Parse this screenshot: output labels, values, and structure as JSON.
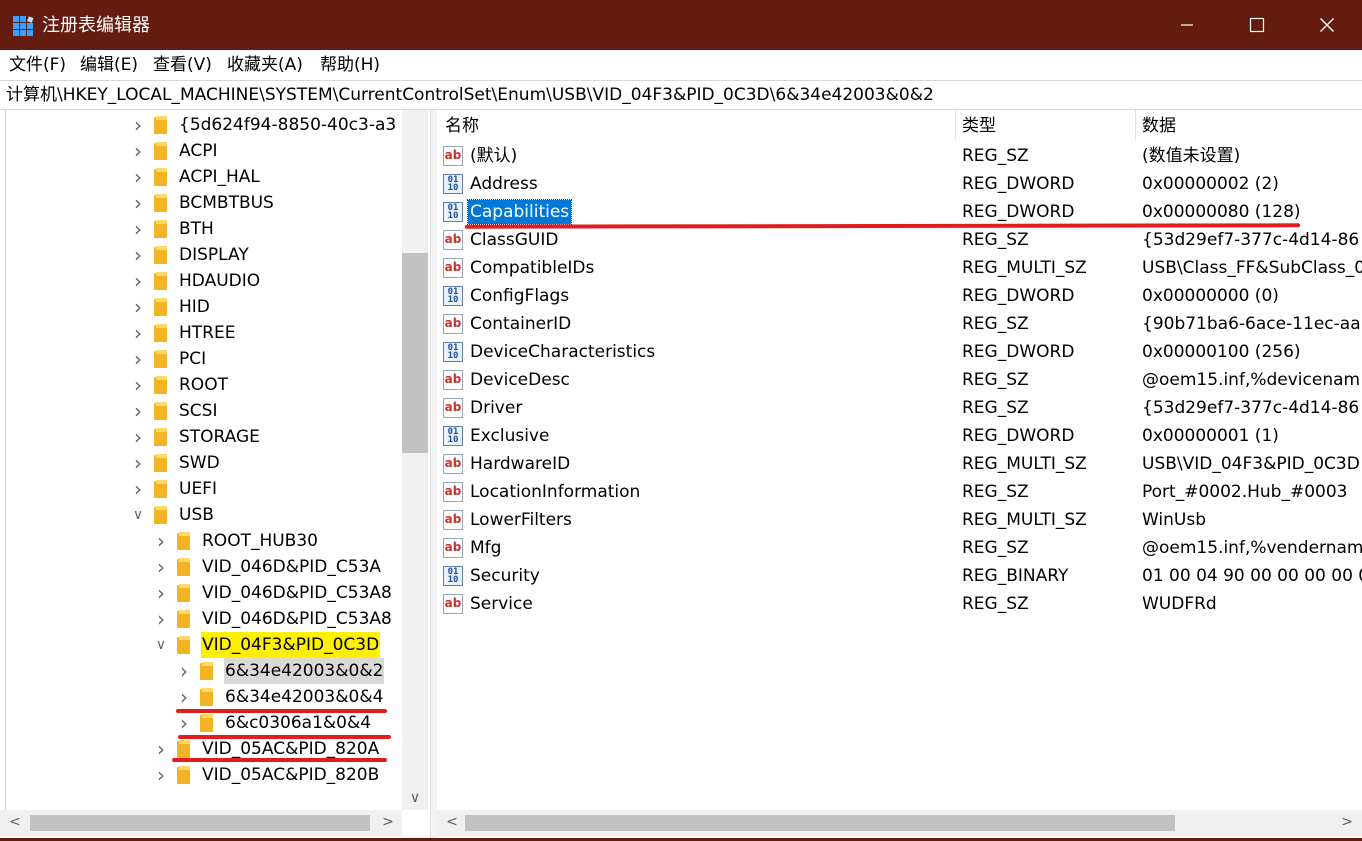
{
  "window": {
    "title": "注册表编辑器",
    "controls": [
      "minimize",
      "maximize",
      "close"
    ]
  },
  "menu": {
    "file": "文件(F)",
    "edit": "编辑(E)",
    "view": "查看(V)",
    "favorites": "收藏夹(A)",
    "help": "帮助(H)"
  },
  "address": {
    "path": "计算机\\HKEY_LOCAL_MACHINE\\SYSTEM\\CurrentControlSet\\Enum\\USB\\VID_04F3&PID_0C3D\\6&34e42003&0&2"
  },
  "tree": {
    "items": [
      {
        "label": "{5d624f94-8850-40c3-a3",
        "expanded": false
      },
      {
        "label": "ACPI",
        "expanded": false
      },
      {
        "label": "ACPI_HAL",
        "expanded": false
      },
      {
        "label": "BCMBTBUS",
        "expanded": false
      },
      {
        "label": "BTH",
        "expanded": false
      },
      {
        "label": "DISPLAY",
        "expanded": false
      },
      {
        "label": "HDAUDIO",
        "expanded": false
      },
      {
        "label": "HID",
        "expanded": false
      },
      {
        "label": "HTREE",
        "expanded": false
      },
      {
        "label": "PCI",
        "expanded": false
      },
      {
        "label": "ROOT",
        "expanded": false
      },
      {
        "label": "SCSI",
        "expanded": false
      },
      {
        "label": "STORAGE",
        "expanded": false
      },
      {
        "label": "SWD",
        "expanded": false
      },
      {
        "label": "UEFI",
        "expanded": false
      },
      {
        "label": "USB",
        "expanded": true
      },
      {
        "label": "ROOT_HUB30",
        "expanded": false
      },
      {
        "label": "VID_046D&PID_C53A",
        "expanded": false
      },
      {
        "label": "VID_046D&PID_C53A8",
        "expanded": false
      },
      {
        "label": "VID_046D&PID_C53A8",
        "expanded": false
      },
      {
        "label": "VID_04F3&PID_0C3D",
        "expanded": true,
        "highlighted": true
      },
      {
        "label": "6&34e42003&0&2",
        "expanded": false,
        "selected": true
      },
      {
        "label": "6&34e42003&0&4",
        "expanded": false
      },
      {
        "label": "6&c0306a1&0&4",
        "expanded": false
      },
      {
        "label": "VID_05AC&PID_820A",
        "expanded": false
      },
      {
        "label": "VID_05AC&PID_820B",
        "expanded": false
      }
    ]
  },
  "values": {
    "headers": {
      "name": "名称",
      "type": "类型",
      "data": "数据"
    },
    "rows": [
      {
        "icon": "string-value-icon",
        "name": "(默认)",
        "type": "REG_SZ",
        "data": "(数值未设置)"
      },
      {
        "icon": "binary-value-icon",
        "name": "Address",
        "type": "REG_DWORD",
        "data": "0x00000002 (2)"
      },
      {
        "icon": "binary-value-icon",
        "name": "Capabilities",
        "type": "REG_DWORD",
        "data": "0x00000080 (128)",
        "selected": true
      },
      {
        "icon": "string-value-icon",
        "name": "ClassGUID",
        "type": "REG_SZ",
        "data": "{53d29ef7-377c-4d14-86"
      },
      {
        "icon": "string-value-icon",
        "name": "CompatibleIDs",
        "type": "REG_MULTI_SZ",
        "data": "USB\\Class_FF&SubClass_0"
      },
      {
        "icon": "binary-value-icon",
        "name": "ConfigFlags",
        "type": "REG_DWORD",
        "data": "0x00000000 (0)"
      },
      {
        "icon": "string-value-icon",
        "name": "ContainerID",
        "type": "REG_SZ",
        "data": "{90b71ba6-6ace-11ec-aa"
      },
      {
        "icon": "binary-value-icon",
        "name": "DeviceCharacteristics",
        "type": "REG_DWORD",
        "data": "0x00000100 (256)"
      },
      {
        "icon": "string-value-icon",
        "name": "DeviceDesc",
        "type": "REG_SZ",
        "data": "@oem15.inf,%devicenam"
      },
      {
        "icon": "string-value-icon",
        "name": "Driver",
        "type": "REG_SZ",
        "data": "{53d29ef7-377c-4d14-86"
      },
      {
        "icon": "binary-value-icon",
        "name": "Exclusive",
        "type": "REG_DWORD",
        "data": "0x00000001 (1)"
      },
      {
        "icon": "string-value-icon",
        "name": "HardwareID",
        "type": "REG_MULTI_SZ",
        "data": "USB\\VID_04F3&PID_0C3D"
      },
      {
        "icon": "string-value-icon",
        "name": "LocationInformation",
        "type": "REG_SZ",
        "data": "Port_#0002.Hub_#0003"
      },
      {
        "icon": "string-value-icon",
        "name": "LowerFilters",
        "type": "REG_MULTI_SZ",
        "data": "WinUsb"
      },
      {
        "icon": "string-value-icon",
        "name": "Mfg",
        "type": "REG_SZ",
        "data": "@oem15.inf,%vendernam"
      },
      {
        "icon": "binary-value-icon",
        "name": "Security",
        "type": "REG_BINARY",
        "data": "01 00 04 90 00 00 00 00 0"
      },
      {
        "icon": "string-value-icon",
        "name": "Service",
        "type": "REG_SZ",
        "data": "WUDFRd"
      }
    ]
  },
  "colors": {
    "titlebar": "#651c10",
    "selection": "#0078d7",
    "highlight": "#ffef00",
    "annotation": "#e11e1e",
    "folder": "#f2b324"
  }
}
